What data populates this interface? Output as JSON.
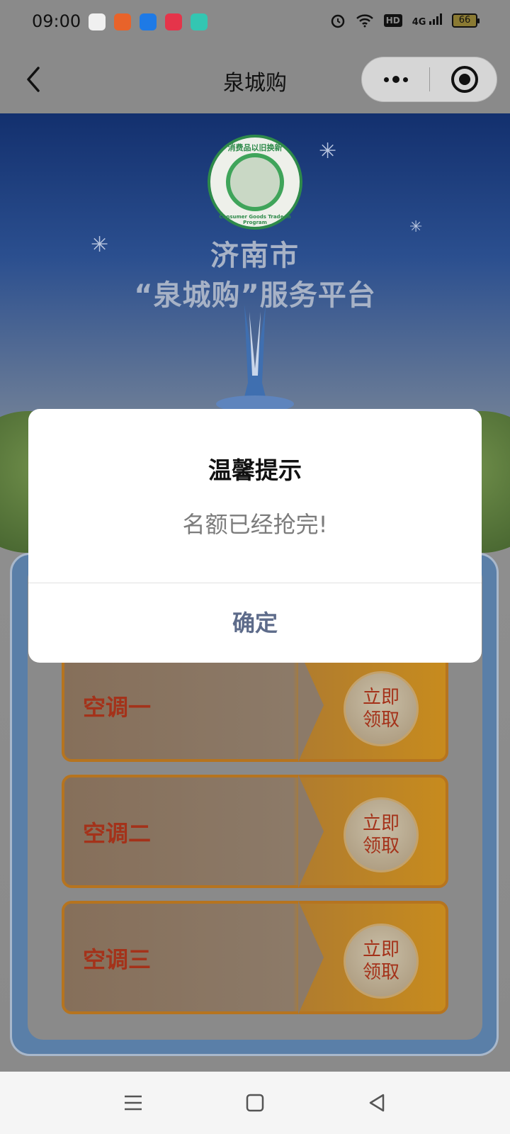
{
  "status_bar": {
    "time": "09:00",
    "network": "4G",
    "hd_label": "HD",
    "battery_level": "66",
    "icons": [
      "alarm-icon",
      "wifi-icon",
      "hd-icon",
      "signal-icon",
      "battery-icon"
    ],
    "app_icon_colors": [
      "#ffffff",
      "#e8632a",
      "#1e7ae6",
      "#e5344a",
      "#33c6b2"
    ]
  },
  "nav": {
    "title": "泉城购"
  },
  "hero": {
    "title_line1": "济南市",
    "title_line2": "“泉城购”服务平台",
    "badge_top_text": "消费品以旧换新",
    "badge_bottom_text": "Consumer Goods Trade-in Program"
  },
  "items": [
    {
      "label": "空调一",
      "button_line1": "立即",
      "button_line2": "领取"
    },
    {
      "label": "空调二",
      "button_line1": "立即",
      "button_line2": "领取"
    },
    {
      "label": "空调三",
      "button_line1": "立即",
      "button_line2": "领取"
    }
  ],
  "modal": {
    "title": "温馨提示",
    "message": "名额已经抢完!",
    "confirm_label": "确定"
  },
  "colors": {
    "accent_text": "#a4321a",
    "modal_confirm": "#5d6b8a",
    "hero_top": "#13306e"
  }
}
